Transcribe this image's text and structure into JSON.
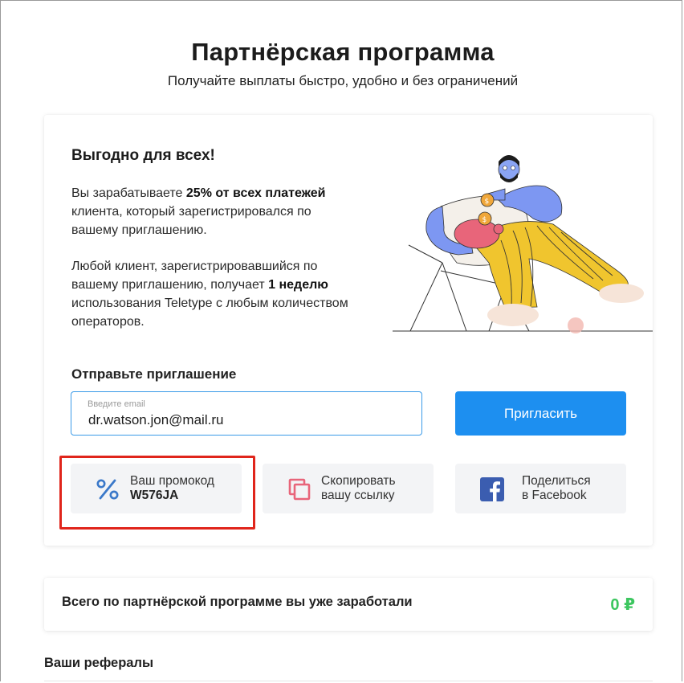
{
  "header": {
    "title": "Партнёрская программа",
    "subtitle": "Получайте выплаты быстро, удобно и без ограничений"
  },
  "benefits": {
    "title": "Выгодно для всех!",
    "p1_pre": "Вы зарабатываете ",
    "p1_bold": "25% от всех платежей",
    "p1_post": " клиента, который зарегистрировался по вашему приглашению.",
    "p2_pre": "Любой клиент, зарегистрировавшийся по вашему приглашению, получает ",
    "p2_bold": "1 неделю",
    "p2_post": " использования Teletype с любым количеством операторов."
  },
  "invite": {
    "label": "Отправьте приглашение",
    "email_placeholder": "Введите email",
    "email_value": "dr.watson.jon@mail.ru",
    "button_label": "Пригласить"
  },
  "actions": {
    "promo_label": "Ваш промокод",
    "promo_code": "W576JA",
    "copy_line1": "Скопировать",
    "copy_line2": "вашу ссылку",
    "share_line1": "Поделиться",
    "share_line2": "в Facebook"
  },
  "earnings": {
    "text": "Всего по партнёрской программе вы уже заработали",
    "value": "0 ₽"
  },
  "referrals": {
    "title": "Ваши рефералы"
  },
  "colors": {
    "primary_blue": "#1d8ff0",
    "earn_green": "#3cc65f",
    "highlight_red": "#e0251b",
    "copy_icon_pink": "#e8657a",
    "facebook_blue": "#3b5db0"
  }
}
